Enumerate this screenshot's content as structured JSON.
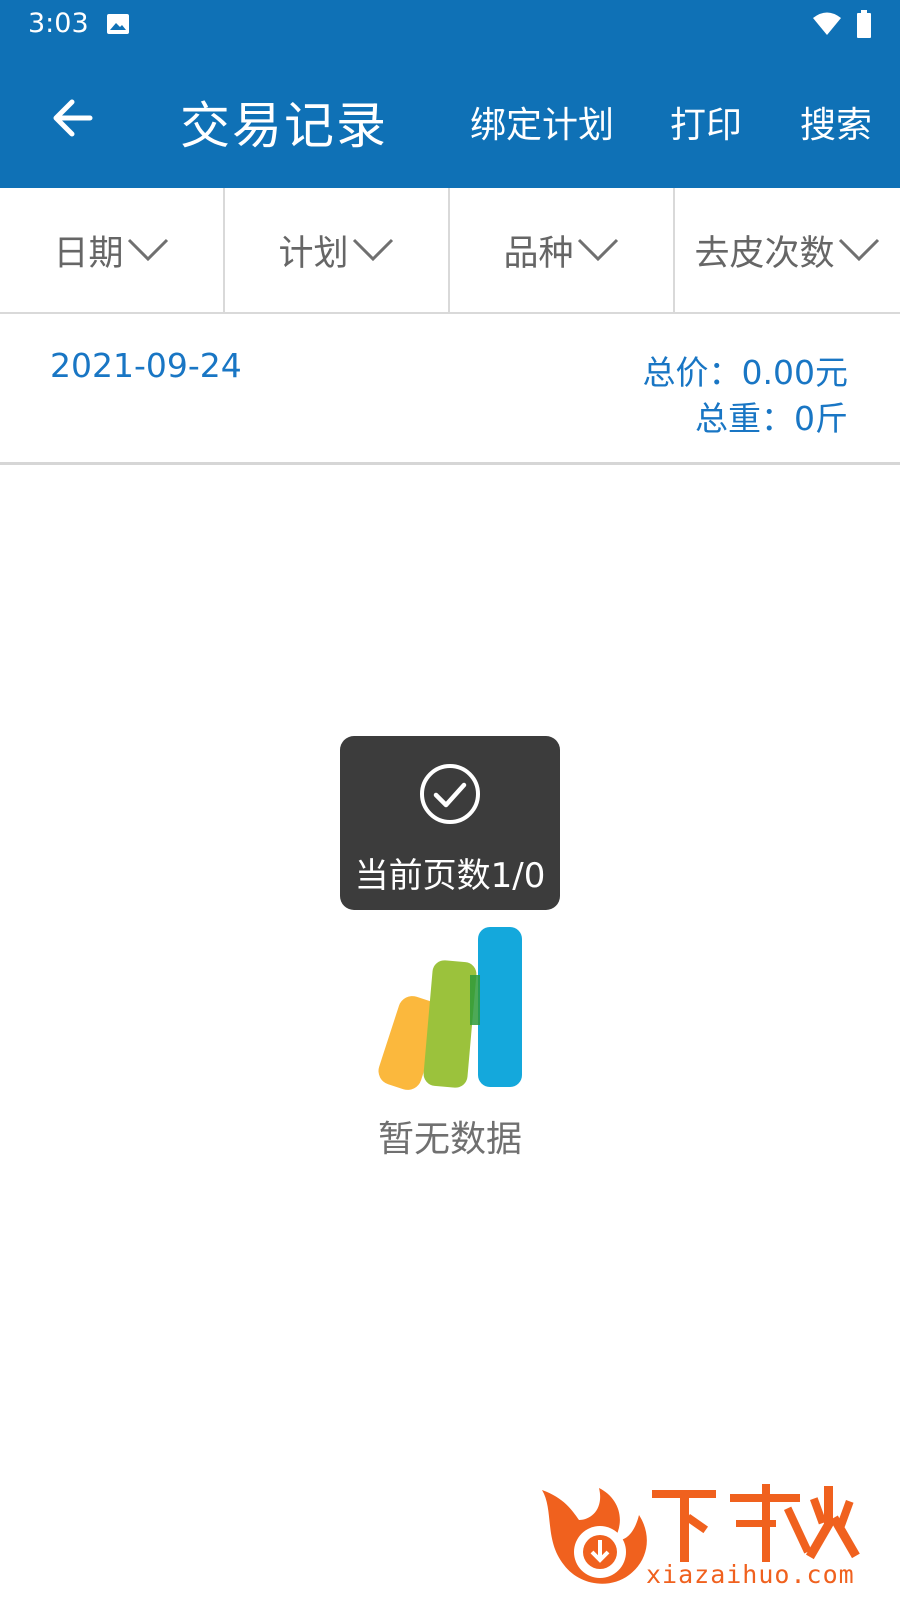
{
  "status_bar": {
    "time": "3:03",
    "icons": [
      "image-icon",
      "wifi-icon",
      "battery-icon"
    ]
  },
  "app_bar": {
    "title": "交易记录",
    "actions": {
      "bind_plan": "绑定计划",
      "print": "打印",
      "search": "搜索"
    },
    "back_icon": "arrow-left-icon",
    "background": "#0f71b6"
  },
  "filters": [
    {
      "label": "日期",
      "icon": "chevron-down-icon"
    },
    {
      "label": "计划",
      "icon": "chevron-down-icon"
    },
    {
      "label": "品种",
      "icon": "chevron-down-icon"
    },
    {
      "label": "去皮次数",
      "icon": "chevron-down-icon"
    }
  ],
  "summary": {
    "date": "2021-09-24",
    "total_price": "总价：0.00元",
    "total_weight": "总重：0斤",
    "color": "#1976c4"
  },
  "toast": {
    "icon": "check-circle-icon",
    "text": "当前页数1/0"
  },
  "empty_state": {
    "icon": "empty-chart-illustration",
    "text": "暂无数据"
  },
  "watermark": {
    "brand": "下载火",
    "site": "xiazaihuo.com",
    "color": "#f0611e"
  }
}
